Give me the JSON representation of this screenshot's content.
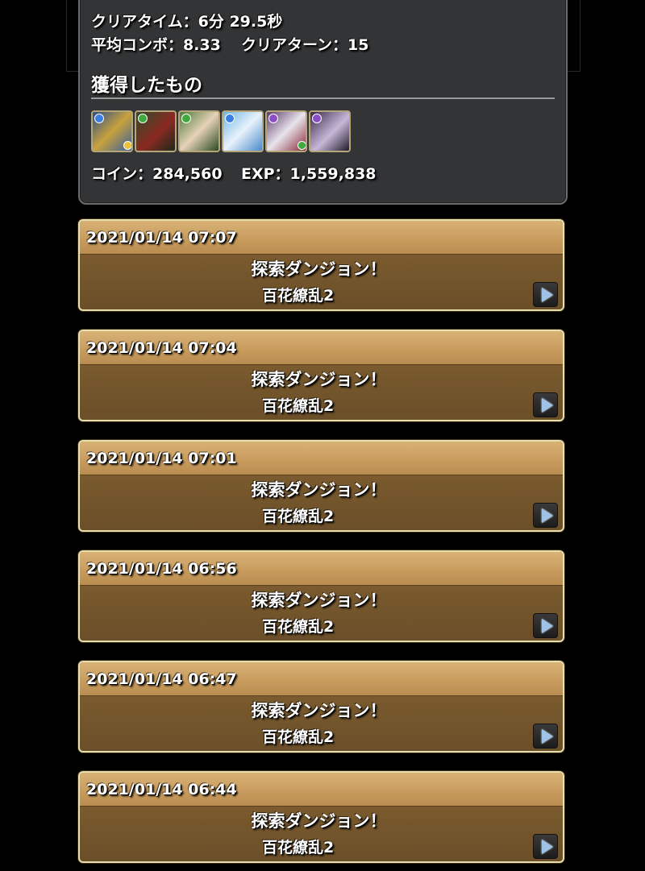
{
  "result": {
    "clear_time": "クリアタイム：6分 29.5秒",
    "avg_combo": "平均コンボ：8.33",
    "clear_turn": "クリアターン：15",
    "earned_title": "獲得したもの",
    "coins": "コイン：284,560",
    "exp": "EXP：1,559,838",
    "monsters": [
      {
        "icon": "dragon-knight-monster-icon",
        "attr_color": "#3b7de0",
        "sub_color": "#e8c23a"
      },
      {
        "icon": "oni-demon-monster-icon",
        "attr_color": "#3fa83f",
        "sub_color": null
      },
      {
        "icon": "green-warrior-girl-monster-icon",
        "attr_color": "#3fa83f",
        "sub_color": null
      },
      {
        "icon": "blue-haired-girl-monster-icon",
        "attr_color": "#3b7de0",
        "sub_color": null
      },
      {
        "icon": "white-haired-witch-monster-icon",
        "attr_color": "#8a4fc8",
        "sub_color": "#3fa83f"
      },
      {
        "icon": "dark-haired-girl-monster-icon",
        "attr_color": "#8a4fc8",
        "sub_color": null
      }
    ]
  },
  "history": [
    {
      "date": "2021/01/14 07:07",
      "type": "探索ダンジョン！",
      "dungeon": "百花繚乱2"
    },
    {
      "date": "2021/01/14 07:04",
      "type": "探索ダンジョン！",
      "dungeon": "百花繚乱2"
    },
    {
      "date": "2021/01/14 07:01",
      "type": "探索ダンジョン！",
      "dungeon": "百花繚乱2"
    },
    {
      "date": "2021/01/14 06:56",
      "type": "探索ダンジョン！",
      "dungeon": "百花繚乱2"
    },
    {
      "date": "2021/01/14 06:47",
      "type": "探索ダンジョン！",
      "dungeon": "百花繚乱2"
    },
    {
      "date": "2021/01/14 06:44",
      "type": "探索ダンジョン！",
      "dungeon": "百花繚乱2"
    }
  ],
  "colors": {
    "entry_header": "#c79a5c",
    "entry_body": "#7a5a2e",
    "entry_border": "#e6dfb0",
    "panel_bg": "#333435",
    "play_arrow": "#9fc3e6"
  }
}
